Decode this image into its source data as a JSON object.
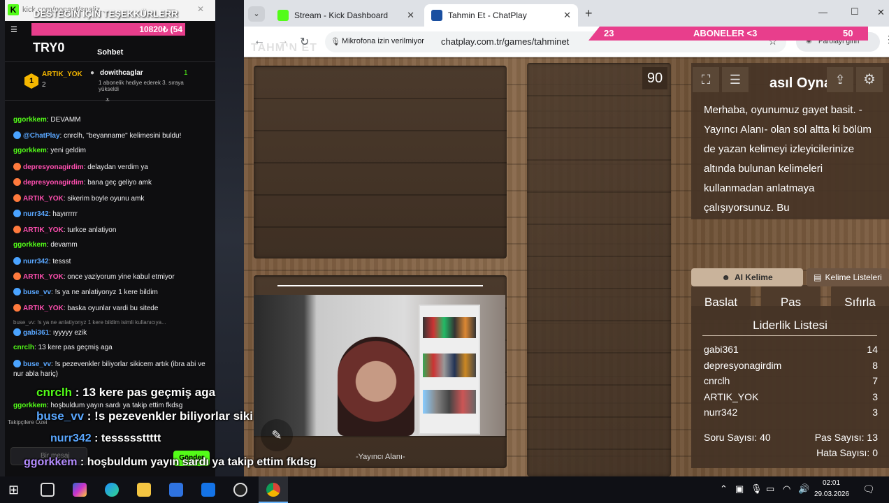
{
  "browser": {
    "tabs": [
      {
        "title": "Stream - Kick Dashboard",
        "close": "✕"
      },
      {
        "title": "Tahmin Et - ChatPlay",
        "close": "✕"
      }
    ],
    "new_tab": "+",
    "window_controls": {
      "minimize": "—",
      "maximize": "☐",
      "close": "✕"
    },
    "mic_notice": "Mikrofona izin verilmiyor",
    "url": "chatplay.com.tr/games/tahminet",
    "password_button": "Parolayı girin"
  },
  "popout": {
    "url": "kick.com/popout/analiz...",
    "goal_text": "DESTEĞİN İÇİN TEŞEKKÜRLERR",
    "goal_value": "10820₺ (54",
    "balance": "TRY0",
    "chat_title": "Sohbet",
    "top_user": {
      "name": "ARTIK_YOK",
      "count": "2"
    },
    "gift_user": {
      "name": "dowithcaglar",
      "count": "1",
      "note": "1 abonelik hediye ederek 3. sıraya yükseldi"
    },
    "messages": [
      {
        "user": "ggorkkem",
        "color": "green",
        "text": ": DEVAMM"
      },
      {
        "user": "@ChatPlay",
        "color": "blue",
        "text": ": cnrclh, \"beyanname\" kelimesini buldu!"
      },
      {
        "user": "ggorkkem",
        "color": "green",
        "text": ": yeni geldim"
      },
      {
        "user": "depresyonagirdim",
        "color": "pink",
        "text": ": delaydan verdim ya"
      },
      {
        "user": "depresyonagirdim",
        "color": "pink",
        "text": ": bana geç geliyo amk"
      },
      {
        "user": "ARTIK_YOK",
        "color": "pink",
        "text": ": sikerim boyle oyunu amk"
      },
      {
        "user": "nurr342",
        "color": "blue",
        "text": ": hayırrrrr"
      },
      {
        "user": "ARTIK_YOK",
        "color": "pink",
        "text": ": turkce anlatiyon"
      },
      {
        "user": "ggorkkem",
        "color": "green",
        "text": ": devamm"
      },
      {
        "user": "nurr342",
        "color": "blue",
        "text": ": tessst"
      },
      {
        "user": "ARTIK_YOK",
        "color": "pink",
        "text": ": once yaziyorum yine kabul etmiyor"
      },
      {
        "user": "buse_vv",
        "color": "blue",
        "text": ": !s ya ne anlatiyonyz 1 kere bildim"
      },
      {
        "user": "ARTIK_YOK",
        "color": "pink",
        "text": ": baska oyunlar vardi bu sitede"
      },
      {
        "user": "gabi361",
        "color": "blue",
        "text": ": ıyyyyy ezik"
      },
      {
        "user": "cnrclh",
        "color": "green",
        "text": ": 13 kere pas geçmiş aga"
      },
      {
        "user": "buse_vv",
        "color": "blue",
        "text": ": !s pezevenkler biliyorlar sikicem artık (ibra abi ve nur abla hariç)"
      },
      {
        "user": "ggorkkem",
        "color": "green",
        "text": ": hoşbuldum yayın sardı ya takip ettim fkdsg"
      }
    ],
    "reply_hint": "buse_vv: !s ya ne anlatiyonyz 1 kere bildim isimli kullanıcıya...",
    "followers_label": "Takipçilere Özel",
    "input_placeholder": "Bir mesaj",
    "send": "Gönder"
  },
  "stream_overlay": {
    "sub_count": "23",
    "sub_label": "ABONELER <3",
    "sub_goal": "50",
    "faded_title": "TAHMIN ET",
    "overlay_chat": [
      {
        "user": "cnrclh",
        "text": " : 13 kere pas geçmiş aga"
      },
      {
        "user": "buse_vv",
        "text": " : !s pezevenkler biliyorlar siki"
      },
      {
        "user": "nurr342",
        "text": " : tesssssttttt"
      },
      {
        "user": "ggorkkem",
        "text": " : hoşbuldum yayın sardı ya takip ettim fkdsg"
      }
    ]
  },
  "game": {
    "timer": "90",
    "how_title": "asıl Oynanı",
    "how_text": "Merhaba, oyunumuz gayet basit. -Yayıncı Alanı- olan sol altta ki bölüm de yazan kelimeyi izleyicilerinize altında bulunan kelimeleri kullanmadan anlatmaya çalışıyorsunuz. Bu",
    "buttons": {
      "start": "Başlat",
      "pass": "Pas",
      "reset": "Sıfırla"
    },
    "ai_word": "AI Kelime",
    "word_lists": "Kelime Listeleri",
    "streamer_area": "-Yayıncı Alanı-",
    "leaderboard": {
      "title": "Liderlik Listesi",
      "rows": [
        {
          "name": "gabi361",
          "score": "14"
        },
        {
          "name": "depresyonagirdim",
          "score": "8"
        },
        {
          "name": "cnrclh",
          "score": "7"
        },
        {
          "name": "ARTIK_YOK",
          "score": "3"
        },
        {
          "name": "nurr342",
          "score": "3"
        }
      ],
      "question_count": "Soru Sayısı: 40",
      "pass_count": "Pas Sayısı: 13",
      "error_count": "Hata Sayısı: 0"
    }
  },
  "taskbar": {
    "time": "02:01",
    "date": "29.03.2026"
  },
  "colors": {
    "kick_green": "#53fc18",
    "goal_pink": "#e83e8c",
    "wood": "#7a5a3d"
  }
}
